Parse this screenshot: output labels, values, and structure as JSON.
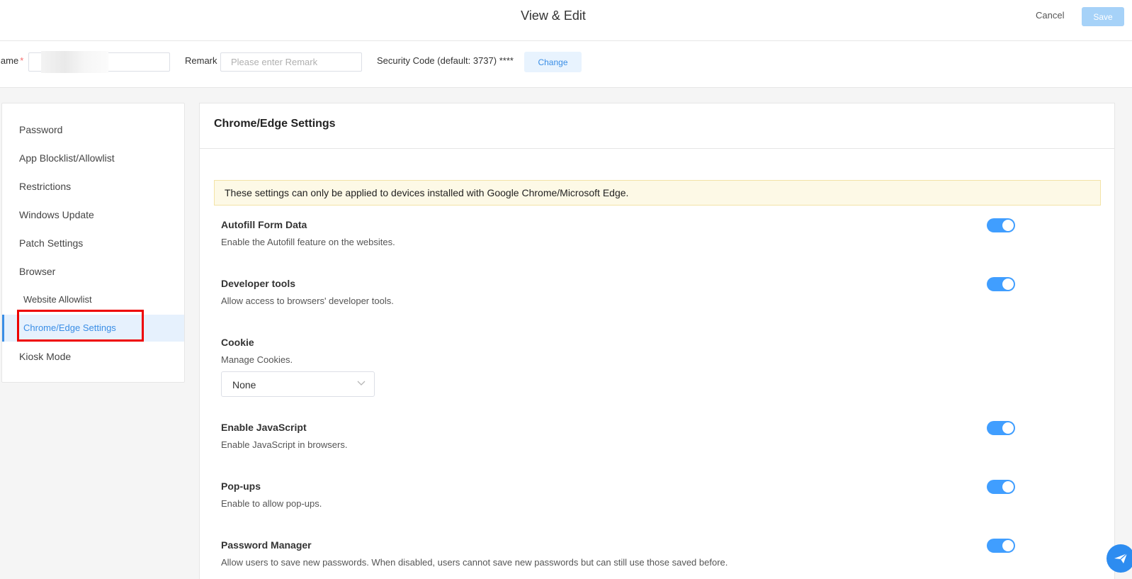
{
  "header": {
    "title": "View & Edit",
    "cancel_label": "Cancel",
    "save_label": "Save"
  },
  "form": {
    "name_label": "lame",
    "name_required": "*",
    "remark_label": "Remark",
    "remark_placeholder": "Please enter Remark",
    "security_code_text": "Security Code (default: 3737) ****",
    "change_label": "Change"
  },
  "sidebar": {
    "items": [
      {
        "label": "Password"
      },
      {
        "label": "App Blocklist/Allowlist"
      },
      {
        "label": "Restrictions"
      },
      {
        "label": "Windows Update"
      },
      {
        "label": "Patch Settings"
      },
      {
        "label": "Browser"
      },
      {
        "label": "Website Allowlist"
      },
      {
        "label": "Chrome/Edge Settings"
      },
      {
        "label": "Kiosk Mode"
      }
    ],
    "active_item": "Chrome/Edge Settings"
  },
  "main": {
    "title": "Chrome/Edge Settings",
    "notice": "These settings can only be applied to devices installed with Google Chrome/Microsoft Edge.",
    "settings": [
      {
        "title": "Autofill Form Data",
        "desc": "Enable the Autofill feature on the websites.",
        "enabled": true
      },
      {
        "title": "Developer tools",
        "desc": "Allow access to browsers' developer tools.",
        "enabled": true
      },
      {
        "title": "Cookie",
        "desc": "Manage Cookies.",
        "select_value": "None"
      },
      {
        "title": "Enable JavaScript",
        "desc": "Enable JavaScript in browsers.",
        "enabled": true
      },
      {
        "title": "Pop-ups",
        "desc": "Enable to allow pop-ups.",
        "enabled": true
      },
      {
        "title": "Password Manager",
        "desc": "Allow users to save new passwords. When disabled, users cannot save new passwords but can still use those saved before.",
        "enabled": true
      }
    ]
  },
  "colors": {
    "accent": "#409eff",
    "highlight": "#ee0000",
    "notice_bg": "#fdf9e6",
    "save_disabled": "#a6d2f8"
  },
  "icons": {
    "fab": "send-icon",
    "select": "chevron-down-icon"
  }
}
